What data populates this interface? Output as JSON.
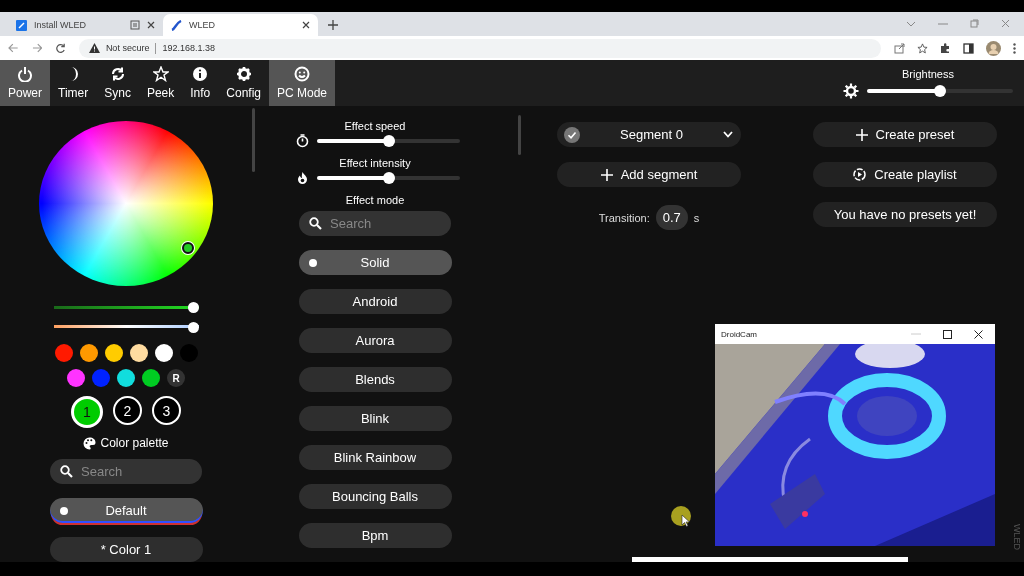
{
  "browser": {
    "tabs": [
      {
        "title": "Install WLED",
        "selected": false
      },
      {
        "title": "WLED",
        "selected": true
      }
    ],
    "security": "Not secure",
    "url": "192.168.1.38"
  },
  "nav": {
    "items": [
      {
        "label": "Power",
        "on": true
      },
      {
        "label": "Timer",
        "on": false
      },
      {
        "label": "Sync",
        "on": false
      },
      {
        "label": "Peek",
        "on": false
      },
      {
        "label": "Info",
        "on": false
      },
      {
        "label": "Config",
        "on": false
      },
      {
        "label": "PC Mode",
        "on": true
      }
    ],
    "brightness": {
      "label": "Brightness",
      "level": 0.5
    }
  },
  "colors": {
    "sliders": [
      {
        "kind": "hue",
        "level": 1
      },
      {
        "kind": "white",
        "level": 1
      }
    ],
    "quick": [
      {
        "color": "#ff1a00"
      },
      {
        "color": "#ff9900"
      },
      {
        "color": "#ffcc00"
      },
      {
        "color": "#ffdca0"
      },
      {
        "color": "#ffffff"
      },
      {
        "color": "#000000"
      },
      {
        "color": "#ff33ff"
      },
      {
        "color": "#0022ff"
      },
      {
        "color": "#11dddd"
      },
      {
        "color": "#00cc22"
      }
    ],
    "random": "R",
    "slots": [
      {
        "label": "1",
        "selected": true,
        "color": "#00cc00"
      },
      {
        "label": "2",
        "selected": false,
        "color": "#000000"
      },
      {
        "label": "3",
        "selected": false,
        "color": "#000000"
      }
    ],
    "palette": {
      "label": "Color palette",
      "placeholder": "Search",
      "items": [
        {
          "label": "Default",
          "selected": true,
          "kind": "gradient"
        },
        {
          "label": "* Color 1",
          "selected": false,
          "kind": "plain"
        }
      ]
    }
  },
  "effects": {
    "speed": {
      "label": "Effect speed",
      "level": 0.5
    },
    "intensity": {
      "label": "Effect intensity",
      "level": 0.5
    },
    "mode_label": "Effect mode",
    "placeholder": "Search",
    "items": [
      {
        "label": "Solid",
        "selected": true
      },
      {
        "label": "Android",
        "selected": false
      },
      {
        "label": "Aurora",
        "selected": false
      },
      {
        "label": "Blends",
        "selected": false
      },
      {
        "label": "Blink",
        "selected": false
      },
      {
        "label": "Blink Rainbow",
        "selected": false
      },
      {
        "label": "Bouncing Balls",
        "selected": false
      },
      {
        "label": "Bpm",
        "selected": false
      }
    ]
  },
  "segments": {
    "segment": {
      "name": "Segment 0",
      "checked": true
    },
    "add_label": "Add segment",
    "transition": {
      "label": "Transition:",
      "value": "0.7",
      "unit": "s"
    }
  },
  "presets": {
    "create_preset": "Create preset",
    "create_playlist": "Create playlist",
    "message": "You have no presets yet!"
  },
  "droidcam": {
    "title": "DroidCam"
  },
  "side_label": "WLED"
}
